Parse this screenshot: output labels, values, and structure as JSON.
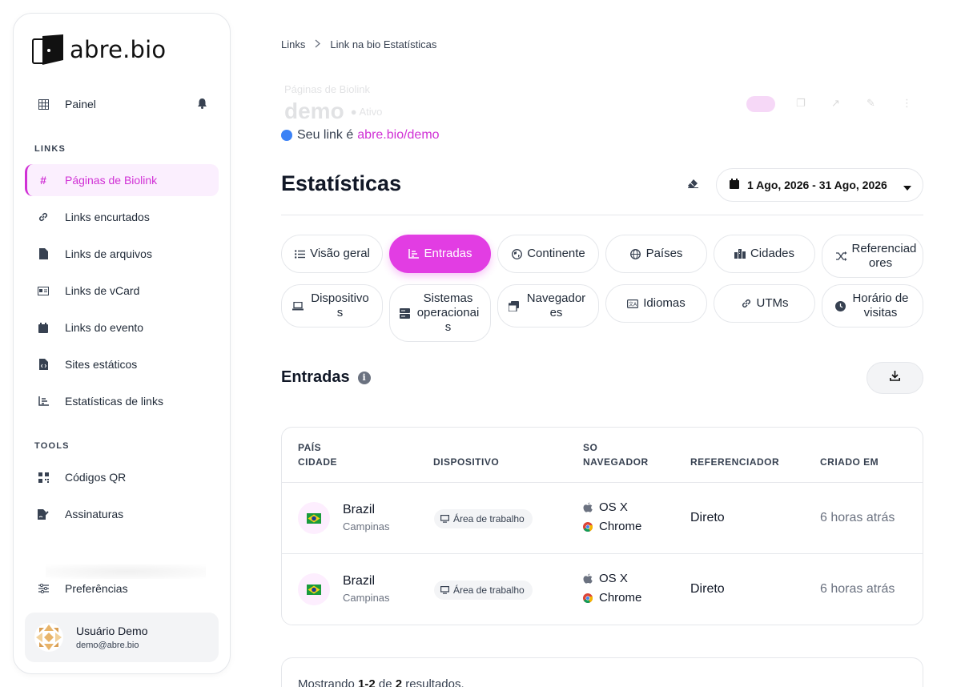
{
  "brand": {
    "name": "abre.bio"
  },
  "sidebar": {
    "dashboard": "Painel",
    "links_section": "LINKS",
    "links": [
      {
        "label": "Páginas de Biolink",
        "icon": "hash-icon",
        "active": true
      },
      {
        "label": "Links encurtados",
        "icon": "link-icon"
      },
      {
        "label": "Links de arquivos",
        "icon": "file-icon"
      },
      {
        "label": "Links de vCard",
        "icon": "vcard-icon"
      },
      {
        "label": "Links do evento",
        "icon": "calendar-icon"
      },
      {
        "label": "Sites estáticos",
        "icon": "file-code-icon"
      },
      {
        "label": "Estatísticas de links",
        "icon": "chart-icon"
      }
    ],
    "tools_section": "TOOLS",
    "tools": [
      {
        "label": "Códigos QR",
        "icon": "qr-icon"
      },
      {
        "label": "Assinaturas",
        "icon": "signature-icon"
      }
    ],
    "preferences": "Preferências",
    "user": {
      "name": "Usuário Demo",
      "email": "demo@abre.bio"
    }
  },
  "breadcrumb": {
    "root": "Links",
    "current": "Link na bio Estatísticas"
  },
  "ghost": {
    "label": "Páginas de Biolink",
    "title": "demo",
    "status": "Ativo"
  },
  "link_info": {
    "prefix": "Seu link é",
    "url": "abre.bio/demo"
  },
  "stats": {
    "title": "Estatísticas",
    "date_range": "1 Ago, 2026 - 31 Ago, 2026"
  },
  "tabs": [
    {
      "label": "Visão geral",
      "icon": "list-icon"
    },
    {
      "label": "Entradas",
      "icon": "chart-icon",
      "active": true
    },
    {
      "label": "Continente",
      "icon": "globe-icon"
    },
    {
      "label": "Países",
      "icon": "globe-icon"
    },
    {
      "label": "Cidades",
      "icon": "city-icon"
    },
    {
      "label": "Referenciadores",
      "icon": "shuffle-icon"
    },
    {
      "label": "Dispositivos",
      "icon": "laptop-icon"
    },
    {
      "label": "Sistemas operacionais",
      "icon": "server-icon"
    },
    {
      "label": "Navegadores",
      "icon": "browser-icon"
    },
    {
      "label": "Idiomas",
      "icon": "language-icon"
    },
    {
      "label": "UTMs",
      "icon": "link-icon"
    },
    {
      "label": "Horário de visitas",
      "icon": "clock-icon"
    }
  ],
  "entries": {
    "title": "Entradas",
    "columns": {
      "country": "PAÍS",
      "city": "CIDADE",
      "device": "DISPOSITIVO",
      "os": "SO",
      "browser": "NAVEGADOR",
      "referrer": "REFERENCIADOR",
      "created": "CRIADO EM"
    },
    "rows": [
      {
        "country": "Brazil",
        "city": "Campinas",
        "device": "Área de trabalho",
        "os": "OS X",
        "browser": "Chrome",
        "referrer": "Direto",
        "created": "6 horas atrás"
      },
      {
        "country": "Brazil",
        "city": "Campinas",
        "device": "Área de trabalho",
        "os": "OS X",
        "browser": "Chrome",
        "referrer": "Direto",
        "created": "6 horas atrás"
      }
    ]
  },
  "pagination": {
    "prefix": "Mostrando",
    "range": "1-2",
    "of": "de",
    "total": "2",
    "suffix": "resultados."
  },
  "colors": {
    "accent": "#e23de3",
    "accent_text": "#d030d5",
    "link_dot": "#3b82f6"
  }
}
